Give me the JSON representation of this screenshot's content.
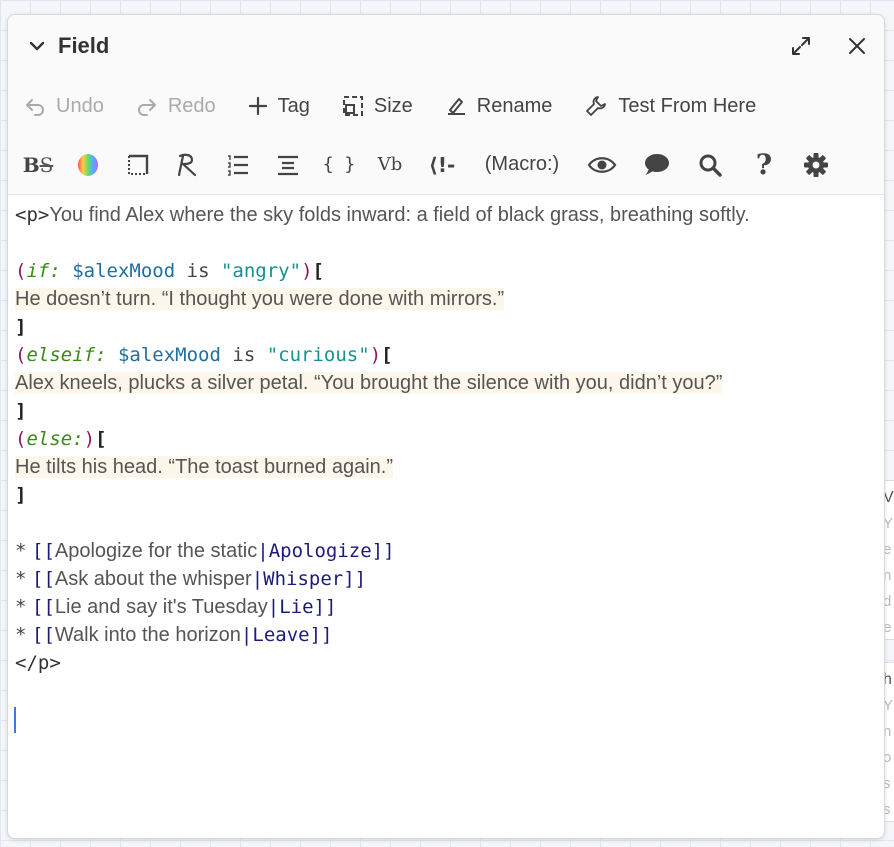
{
  "window": {
    "title": "Field",
    "collapse_icon": "chevron-down-icon",
    "maximize_icon": "maximize-icon",
    "close_icon": "close-icon"
  },
  "toolbar": {
    "undo": "Undo",
    "redo": "Redo",
    "tag": "Tag",
    "size": "Size",
    "rename": "Rename",
    "test": "Test From Here"
  },
  "format_toolbar": {
    "bold_label": "B",
    "s_label": "S",
    "vb_label": "Vb",
    "braces_label": "{ }",
    "comment_label": "⟨!-",
    "macro_label": "(Macro:)"
  },
  "editor": {
    "p_open": "<p>",
    "intro": "You find Alex where the sky folds inward: a field of black grass, breathing softly.",
    "if_open": "(",
    "if_name": "if:",
    "if_var": "$alexMood",
    "is1": "is",
    "angry": "\"angry\"",
    "close_paren": ")",
    "open_bracket": "[",
    "angry_text": "He doesn’t turn. “I thought you were done with mirrors.”",
    "close_bracket": "]",
    "elseif_name": "elseif:",
    "curious": "\"curious\"",
    "curious_text": "Alex kneels, plucks a silver petal. “You brought the silence with you, didn’t you?”",
    "else_name": "else:",
    "else_text": "He tilts his head. “The toast burned again.”",
    "bullet": "*",
    "link_open": "[[",
    "link_close": "]]",
    "pipe": "|",
    "links": [
      {
        "text": "Apologize for the static",
        "target": "Apologize"
      },
      {
        "text": "Ask about the whisper",
        "target": "Whisper"
      },
      {
        "text": "Lie and say it's Tuesday",
        "target": "Lie"
      },
      {
        "text": "Walk into the horizon",
        "target": "Leave"
      }
    ],
    "p_close": "</p>"
  },
  "colors": {
    "macro_paren": "#8b1a5b",
    "macro_name": "#3a8a1a",
    "variable": "#1f6fa0",
    "string": "#17918f",
    "link_target": "#1b1b7a",
    "hook_highlight": "#fdf6ea",
    "cursor": "#3b7be0"
  }
}
